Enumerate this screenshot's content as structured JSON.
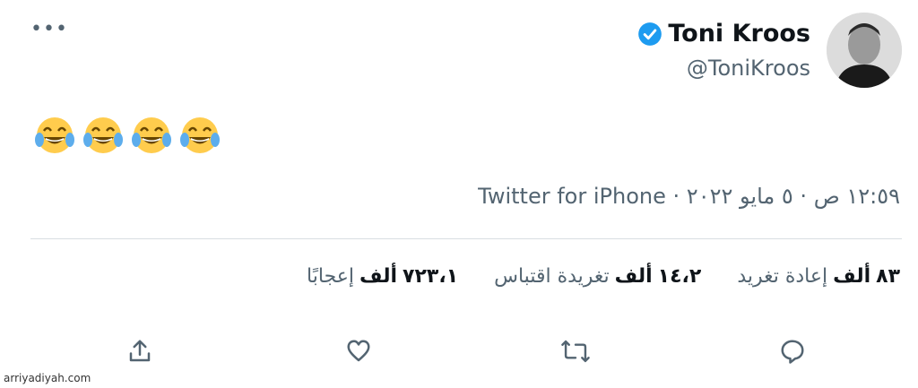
{
  "tweet": {
    "more_label": "•••",
    "author": {
      "name": "Toni Kroos",
      "handle": "@ToniKroos"
    },
    "content_emojis": [
      "😂",
      "😂",
      "😂",
      "😂"
    ],
    "meta": {
      "time": "١٢:٥٩ ص",
      "date": "٥ مايو ٢٠٢٢",
      "source": "Twitter for iPhone",
      "separator": "·"
    },
    "stats": [
      {
        "value": "٨٣",
        "unit": "ألف",
        "label": "إعادة تغريد"
      },
      {
        "value": "١٤،٢",
        "unit": "ألف",
        "label": "تغريدة اقتباس"
      },
      {
        "value": "٧٢٣،١",
        "unit": "ألف",
        "label": "إعجابًا"
      }
    ],
    "icon_color": "#536471",
    "verified_color": "#1d9bf0"
  },
  "watermark": "arriyadiyah.com"
}
